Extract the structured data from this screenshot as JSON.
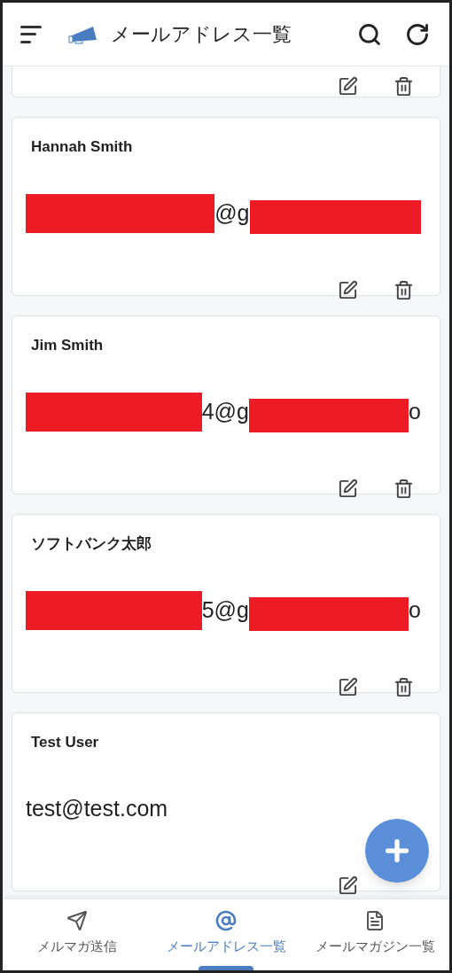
{
  "header": {
    "title": "メールアドレス一覧"
  },
  "contacts": [
    {
      "name": "Hannah Smith",
      "email": [
        {
          "kind": "redacted"
        },
        {
          "kind": "text",
          "text": "@g"
        },
        {
          "kind": "redacted"
        }
      ]
    },
    {
      "name": "Jim Smith",
      "email": [
        {
          "kind": "redacted"
        },
        {
          "kind": "text",
          "text": "4@g"
        },
        {
          "kind": "redacted"
        },
        {
          "kind": "text",
          "text": "o"
        }
      ]
    },
    {
      "name": "ソフトバンク太郎",
      "email": [
        {
          "kind": "redacted"
        },
        {
          "kind": "text",
          "text": "5@g"
        },
        {
          "kind": "redacted"
        },
        {
          "kind": "text",
          "text": "o"
        }
      ]
    },
    {
      "name": "Test User",
      "email": [
        {
          "kind": "text",
          "text": "test@test.com"
        }
      ]
    }
  ],
  "nav": [
    {
      "label": "メルマガ送信",
      "kind": "send",
      "selected": false
    },
    {
      "label": "メールアドレス一覧",
      "kind": "address",
      "selected": true
    },
    {
      "label": "メールマガジン一覧",
      "kind": "magazine",
      "selected": false
    }
  ]
}
